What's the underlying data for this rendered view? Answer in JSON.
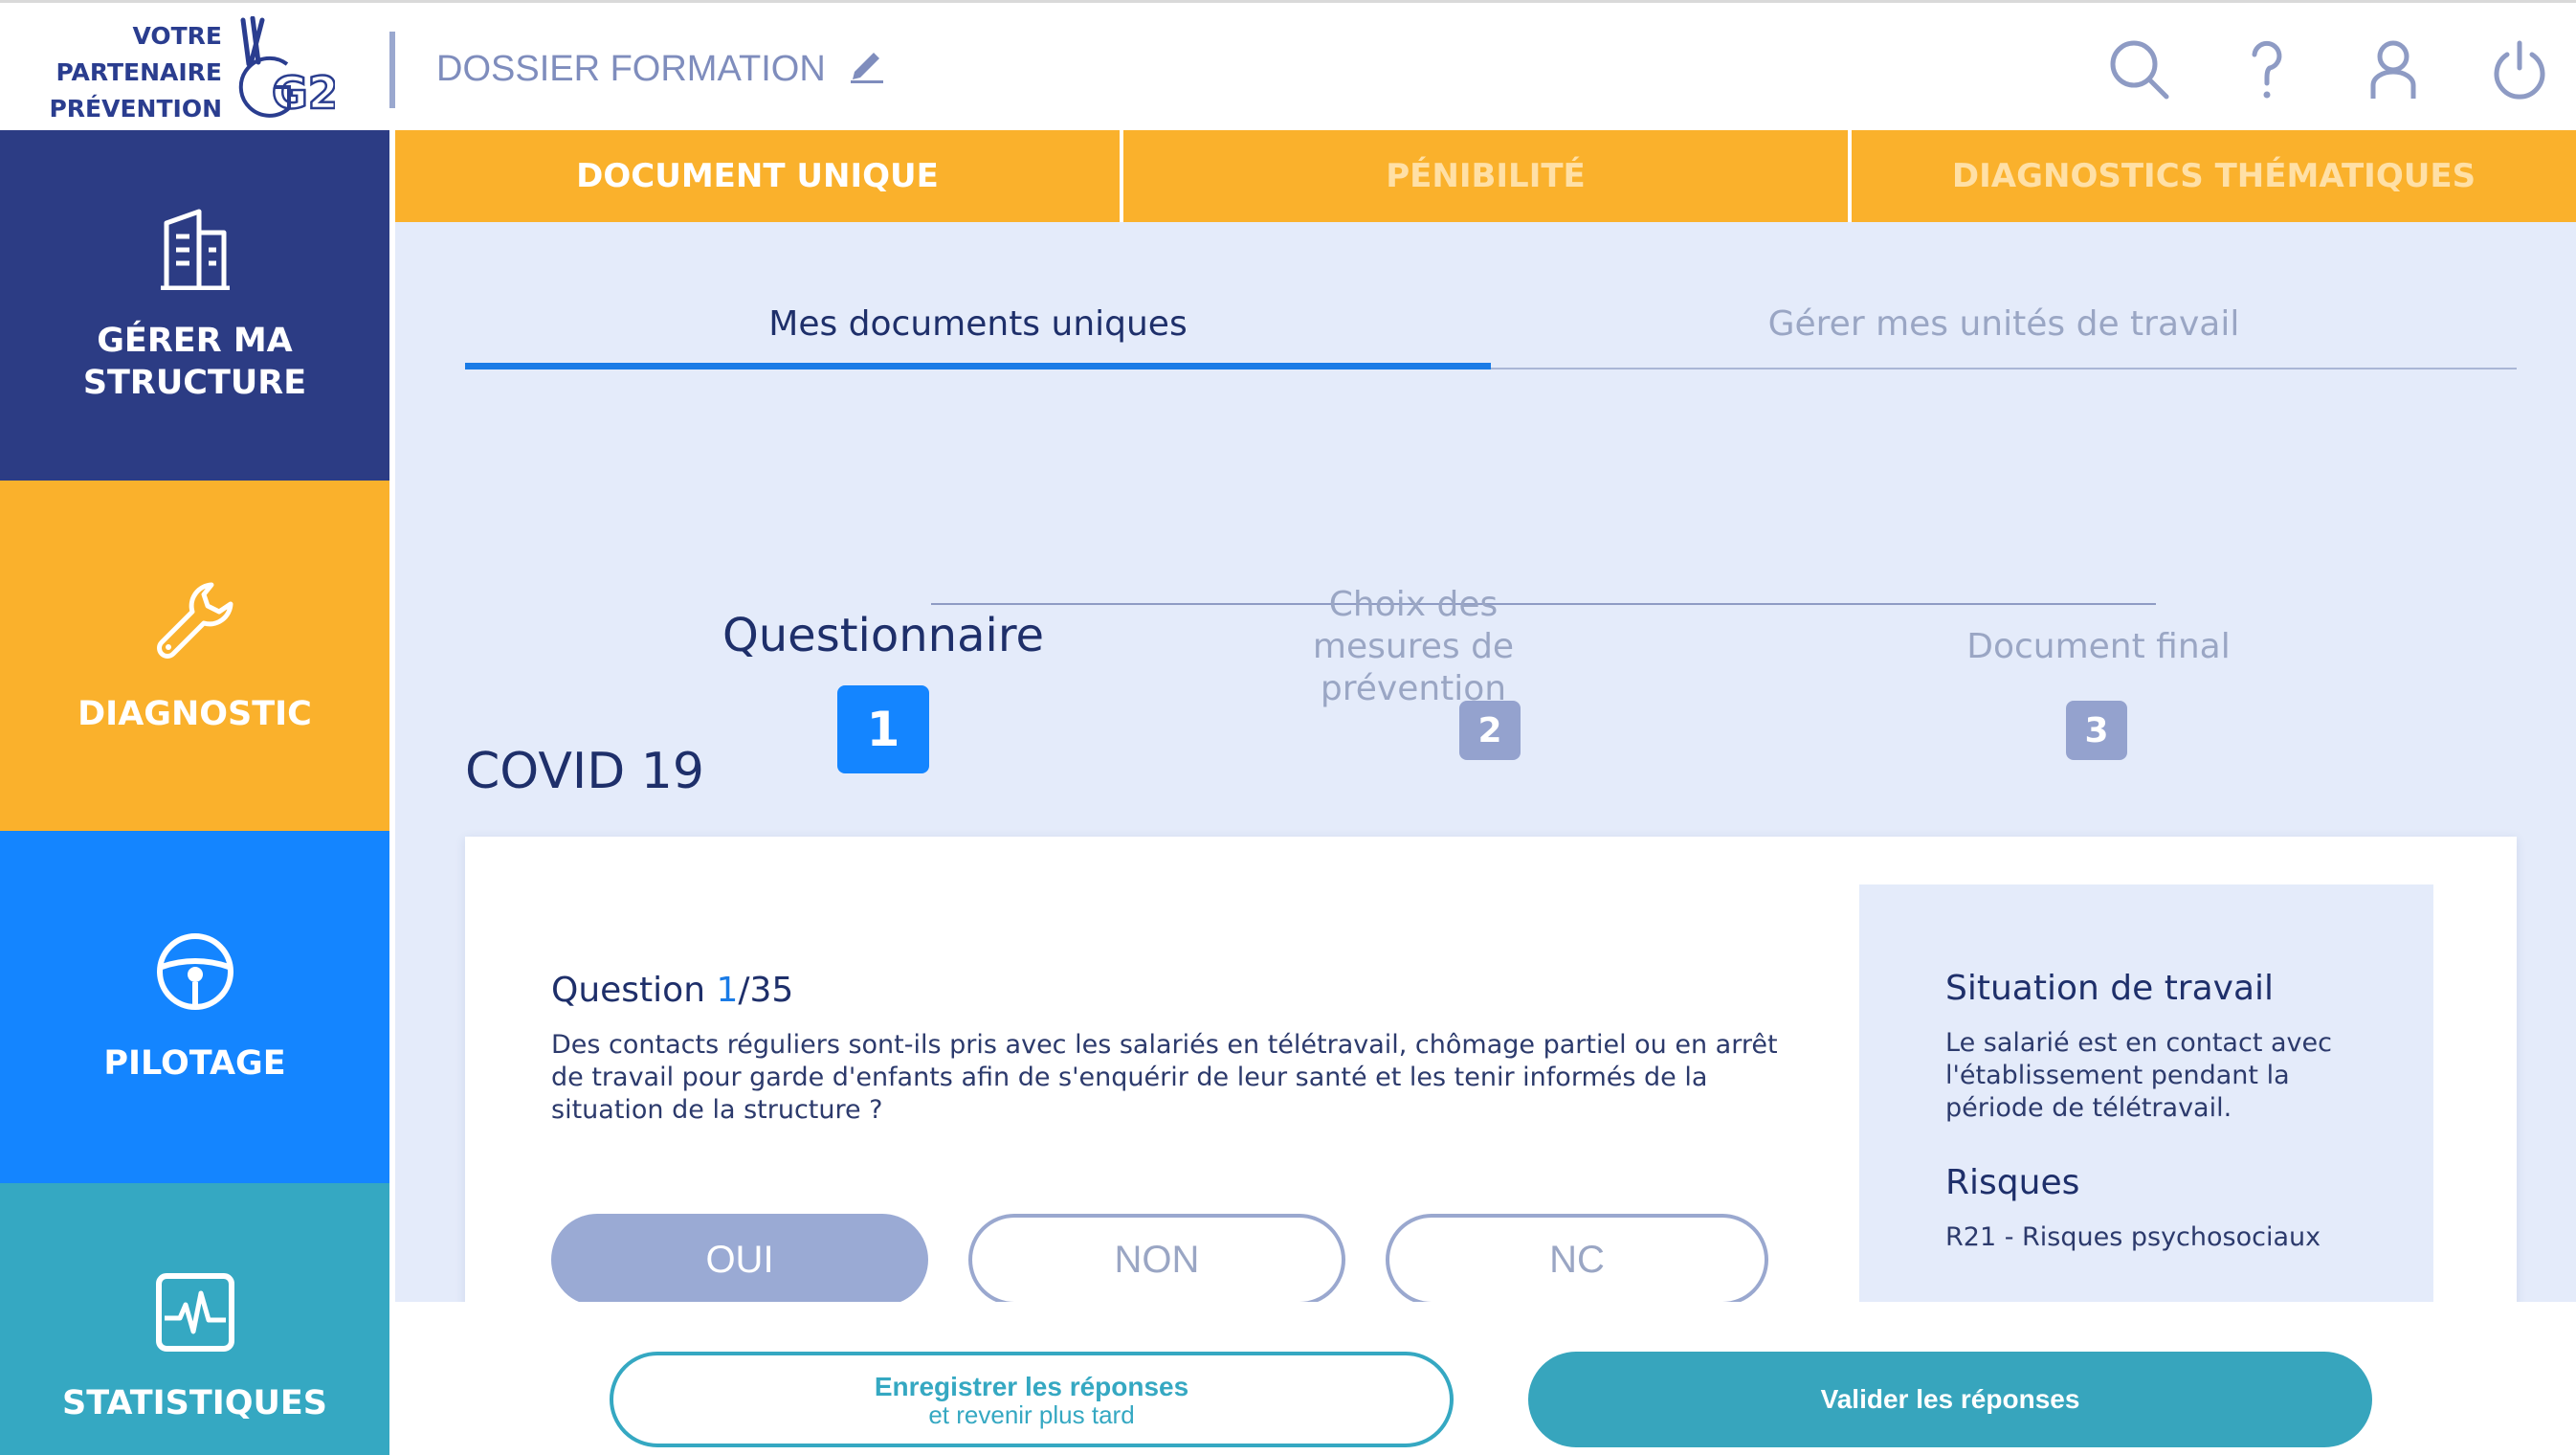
{
  "header": {
    "logo_lines": [
      "VOTRE",
      "PARTENAIRE",
      "PRÉVENTION"
    ],
    "logo_mark": "G2P",
    "dossier_title": "DOSSIER FORMATION",
    "icons": [
      "search-icon",
      "help-icon",
      "user-icon",
      "power-icon"
    ]
  },
  "sidebar": {
    "items": [
      {
        "label": "GÉRER MA\nSTRUCTURE",
        "icon": "building-icon",
        "color": "#2c3c84"
      },
      {
        "label": "DIAGNOSTIC",
        "icon": "wrench-icon",
        "color": "#fab12c"
      },
      {
        "label": "PILOTAGE",
        "icon": "steering-wheel-icon",
        "color": "#1485ff"
      },
      {
        "label": "STATISTIQUES",
        "icon": "pulse-chart-icon",
        "color": "#35a8c2"
      }
    ]
  },
  "main_tabs": [
    {
      "label": "DOCUMENT UNIQUE",
      "active": true
    },
    {
      "label": "PÉNIBILITÉ",
      "active": false
    },
    {
      "label": "DIAGNOSTICS THÉMATIQUES",
      "active": false
    }
  ],
  "sub_tabs": [
    {
      "label": "Mes documents uniques",
      "active": true
    },
    {
      "label": "Gérer mes unités de travail",
      "active": false
    }
  ],
  "stepper": {
    "steps": [
      {
        "label": "Questionnaire",
        "number": "1",
        "active": true
      },
      {
        "label": "Choix des mesures de prévention",
        "number": "2",
        "active": false
      },
      {
        "label": "Document final",
        "number": "3",
        "active": false
      }
    ]
  },
  "section_title": "COVID 19",
  "question": {
    "prefix": "Question ",
    "current": "1",
    "total": "/35",
    "text": "Des contacts réguliers sont-ils pris avec les salariés en télétravail, chômage partiel ou en arrêt de travail pour garde d'enfants afin de s'enquérir de leur santé et les tenir informés de la situation de la structure ?",
    "answers": [
      {
        "label": "OUI",
        "selected": true
      },
      {
        "label": "NON",
        "selected": false
      },
      {
        "label": "NC",
        "selected": false
      }
    ]
  },
  "info_panel": {
    "situation_title": "Situation de travail",
    "situation_text": "Le salarié est en contact avec l'établissement pendant la période de télétravail.",
    "risks_title": "Risques",
    "risks_text": "R21 - Risques psychosociaux"
  },
  "actions": {
    "save_line1": "Enregistrer les réponses",
    "save_line2": "et revenir plus tard",
    "validate": "Valider les réponses"
  },
  "colors": {
    "navy": "#2c3c84",
    "orange": "#fab12c",
    "blue": "#1485ff",
    "teal": "#35a8c2",
    "panel_bg": "#e4ebfa"
  }
}
